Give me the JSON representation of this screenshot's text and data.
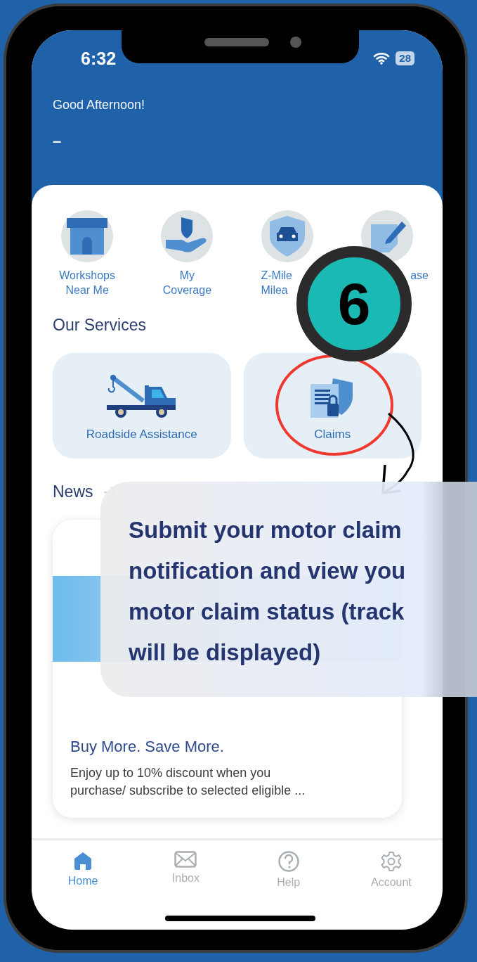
{
  "status_bar": {
    "time": "6:32",
    "battery": "28"
  },
  "header": {
    "greeting": "Good Afternoon!",
    "name": "–"
  },
  "quick_links": [
    {
      "kind": "workshop",
      "label_lines": [
        "Workshops",
        "Near Me"
      ],
      "covered_right": false,
      "covered_left": false
    },
    {
      "kind": "coverage",
      "label_lines": [
        "My",
        "Coverage"
      ],
      "covered_right": false,
      "covered_left": false
    },
    {
      "kind": "mileage",
      "label_lines": [
        "Z-Mile",
        "Milea"
      ],
      "covered_right": true,
      "covered_left": false
    },
    {
      "kind": "note",
      "label_lines": [
        "ase"
      ],
      "covered_right": false,
      "covered_left": true
    }
  ],
  "services": {
    "title": "Our Services",
    "items": [
      {
        "kind": "tow",
        "label": "Roadside Assistance",
        "highlighted": false
      },
      {
        "kind": "claims",
        "label": "Claims",
        "highlighted": true
      }
    ]
  },
  "news": {
    "title": "News",
    "cards": [
      {
        "title": "Buy More. Save More.",
        "description": "Enjoy up to 10% discount when you\npurchase/ subscribe to selected eligible ..."
      }
    ]
  },
  "tab_bar": [
    {
      "kind": "home",
      "label": "Home",
      "selected": true
    },
    {
      "kind": "inbox",
      "label": "Inbox",
      "selected": false
    },
    {
      "kind": "help",
      "label": "Help",
      "selected": false
    },
    {
      "kind": "account",
      "label": "Account",
      "selected": false
    }
  ],
  "tutorial": {
    "step": "6",
    "lines": [
      "Submit your motor claim",
      "notification and view you",
      "motor claim status (track",
      "will be displayed)"
    ]
  }
}
